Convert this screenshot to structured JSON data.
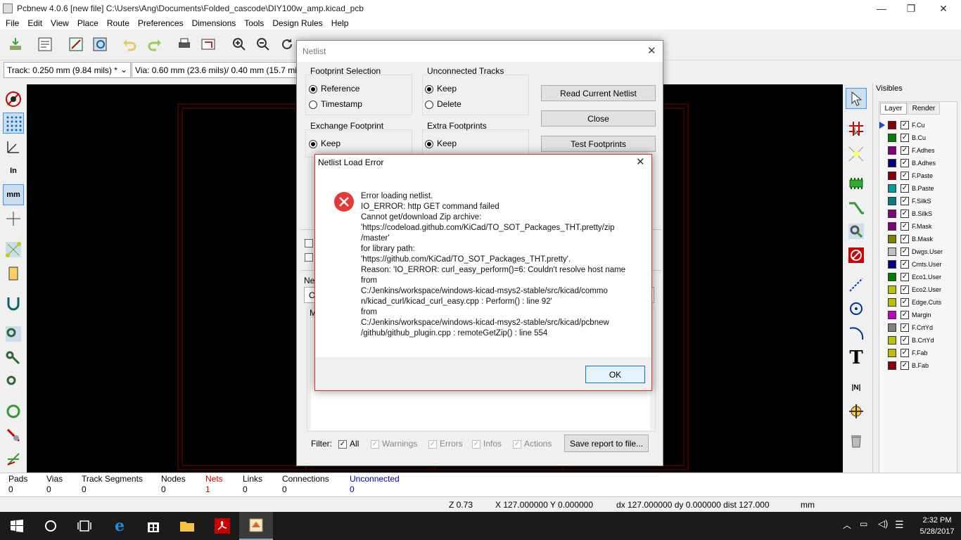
{
  "window": {
    "title": "Pcbnew 4.0.6  [new file] C:\\Users\\Ang\\Documents\\Folded_cascode\\DIY100w_amp.kicad_pcb",
    "minimize": "—",
    "maximize": "❐",
    "close": "✕"
  },
  "menu": [
    "File",
    "Edit",
    "View",
    "Place",
    "Route",
    "Preferences",
    "Dimensions",
    "Tools",
    "Design Rules",
    "Help"
  ],
  "toolbar": {
    "track": "Track: 0.250 mm (9.84 mils) *",
    "via": "Via: 0.60 mm (23.6 mils)/ 0.40 mm (15.7 mils"
  },
  "netlist": {
    "title": "Netlist",
    "close": "✕",
    "footprint_selection": {
      "label": "Footprint Selection",
      "opt1": "Reference",
      "opt2": "Timestamp"
    },
    "unconnected": {
      "label": "Unconnected Tracks",
      "opt1": "Keep",
      "opt2": "Delete"
    },
    "exchange": {
      "label": "Exchange Footprint",
      "opt1": "Keep"
    },
    "extra": {
      "label": "Extra Footprints",
      "opt1": "Keep"
    },
    "buttons": {
      "read": "Read Current Netlist",
      "close": "Close",
      "test": "Test Footprints"
    },
    "partial": {
      "ne": "Ne",
      "c": "C",
      "m": "M"
    },
    "filter": {
      "label": "Filter:",
      "all": "All",
      "warnings": "Warnings",
      "errors": "Errors",
      "infos": "Infos",
      "actions": "Actions",
      "save": "Save report to file..."
    }
  },
  "error": {
    "title": "Netlist Load Error",
    "close": "✕",
    "message": "Error loading netlist.\nIO_ERROR: http GET command failed\nCannot get/download Zip archive:\n'https://codeload.github.com/KiCad/TO_SOT_Packages_THT.pretty/zip\n/master'\nfor library path:\n'https://github.com/KiCad/TO_SOT_Packages_THT.pretty'.\nReason: 'IO_ERROR: curl_easy_perform()=6: Couldn't resolve host name\nfrom\nC:/Jenkins/workspace/windows-kicad-msys2-stable/src/kicad/commo\nn/kicad_curl/kicad_curl_easy.cpp : Perform() : line 92'\nfrom\nC:/Jenkins/workspace/windows-kicad-msys2-stable/src/kicad/pcbnew\n/github/github_plugin.cpp : remoteGetZip() : line 554",
    "ok": "OK"
  },
  "layers": {
    "header": "Visibles",
    "tab_layer": "Layer",
    "tab_render": "Render",
    "items": [
      {
        "name": "F.Cu",
        "color": "#8b0000"
      },
      {
        "name": "B.Cu",
        "color": "#008000"
      },
      {
        "name": "F.Adhes",
        "color": "#800080"
      },
      {
        "name": "B.Adhes",
        "color": "#000080"
      },
      {
        "name": "F.Paste",
        "color": "#8b0000"
      },
      {
        "name": "B.Paste",
        "color": "#00a0a0"
      },
      {
        "name": "F.SilkS",
        "color": "#008080"
      },
      {
        "name": "B.SilkS",
        "color": "#800080"
      },
      {
        "name": "F.Mask",
        "color": "#800080"
      },
      {
        "name": "B.Mask",
        "color": "#808000"
      },
      {
        "name": "Dwgs.User",
        "color": "#c0c0c0"
      },
      {
        "name": "Cmts.User",
        "color": "#000080"
      },
      {
        "name": "Eco1.User",
        "color": "#008000"
      },
      {
        "name": "Eco2.User",
        "color": "#c0c000"
      },
      {
        "name": "Edge.Cuts",
        "color": "#c0c000"
      },
      {
        "name": "Margin",
        "color": "#c000c0"
      },
      {
        "name": "F.CrtYd",
        "color": "#808080"
      },
      {
        "name": "B.CrtYd",
        "color": "#c0c000"
      },
      {
        "name": "F.Fab",
        "color": "#c0c000"
      },
      {
        "name": "B.Fab",
        "color": "#8b0000"
      }
    ]
  },
  "status": {
    "pads": {
      "label": "Pads",
      "value": "0"
    },
    "vias": {
      "label": "Vias",
      "value": "0"
    },
    "tracks": {
      "label": "Track Segments",
      "value": "0"
    },
    "nodes": {
      "label": "Nodes",
      "value": "0"
    },
    "nets": {
      "label": "Nets",
      "value": "1"
    },
    "links": {
      "label": "Links",
      "value": "0"
    },
    "connections": {
      "label": "Connections",
      "value": "0"
    },
    "unconnected": {
      "label": "Unconnected",
      "value": "0"
    }
  },
  "coords": {
    "zoom": "Z 0.73",
    "xy": "X 127.000000  Y 0.000000",
    "dist": "dx 127.000000  dy 0.000000  dist 127.000",
    "unit": "mm"
  },
  "taskbar": {
    "time": "2:32 PM",
    "date": "5/28/2017"
  }
}
